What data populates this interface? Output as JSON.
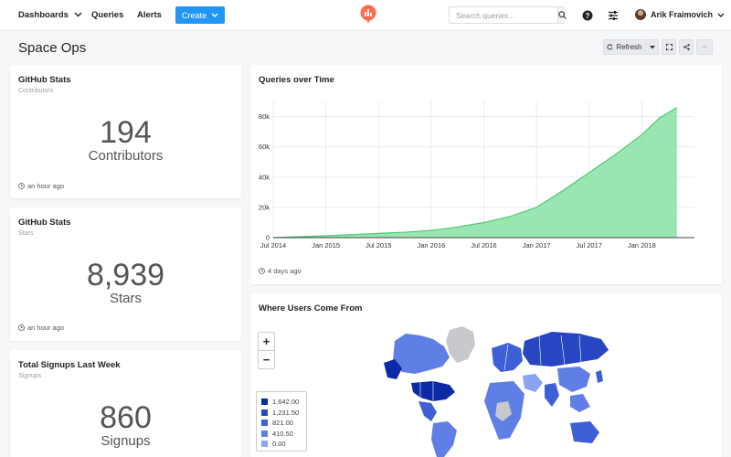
{
  "nav": {
    "dashboards": "Dashboards",
    "queries": "Queries",
    "alerts": "Alerts",
    "create": "Create",
    "search_placeholder": "Search queries...",
    "user_name": "Arik Fraimovich"
  },
  "page": {
    "title": "Space Ops",
    "refresh": "Refresh",
    "more": "···"
  },
  "widgets": {
    "contributors": {
      "title": "GitHub Stats",
      "subtitle": "Contributors",
      "value": "194",
      "label": "Contributors",
      "updated": "an hour ago"
    },
    "stars": {
      "title": "GitHub Stats",
      "subtitle": "Stars",
      "value": "8,939",
      "label": "Stars",
      "updated": "an hour ago"
    },
    "signups": {
      "title": "Total Signups Last Week",
      "subtitle": "Signups",
      "value": "860",
      "label": "Signups"
    },
    "queries_chart": {
      "title": "Queries over Time",
      "updated": "4 days ago"
    },
    "map": {
      "title": "Where Users Come From",
      "zoom_in": "+",
      "zoom_out": "−",
      "legend": [
        {
          "label": "1,642.00",
          "color": "#0c2aa6"
        },
        {
          "label": "1,231.50",
          "color": "#2846c2"
        },
        {
          "label": "821.00",
          "color": "#3e5fd6"
        },
        {
          "label": "410.50",
          "color": "#5f7fe6"
        },
        {
          "label": "0.00",
          "color": "#8aa4f2"
        }
      ]
    }
  },
  "colors": {
    "accent": "#2196f3",
    "area_fill": "#8fe3a8",
    "area_stroke": "#4cc973"
  },
  "chart_data": {
    "type": "area",
    "title": "Queries over Time",
    "xlabel": "",
    "ylabel": "",
    "x_ticks": [
      "Jul 2014",
      "Jan 2015",
      "Jul 2015",
      "Jan 2016",
      "Jul 2016",
      "Jan 2017",
      "Jul 2017",
      "Jan 2018"
    ],
    "y_ticks": [
      "0",
      "20k",
      "40k",
      "60k",
      "80k"
    ],
    "ylim": [
      0,
      90000
    ],
    "grid": true,
    "series": [
      {
        "x": [
          "2014-07",
          "2014-10",
          "2015-01",
          "2015-04",
          "2015-07",
          "2015-10",
          "2016-01",
          "2016-04",
          "2016-07",
          "2016-10",
          "2017-01",
          "2017-04",
          "2017-07",
          "2017-10",
          "2018-01",
          "2018-03",
          "2018-05"
        ],
        "values": [
          0,
          600,
          1200,
          2000,
          2800,
          3600,
          4800,
          7000,
          10000,
          14000,
          20000,
          31000,
          43000,
          55000,
          68000,
          79000,
          86000
        ]
      }
    ]
  }
}
